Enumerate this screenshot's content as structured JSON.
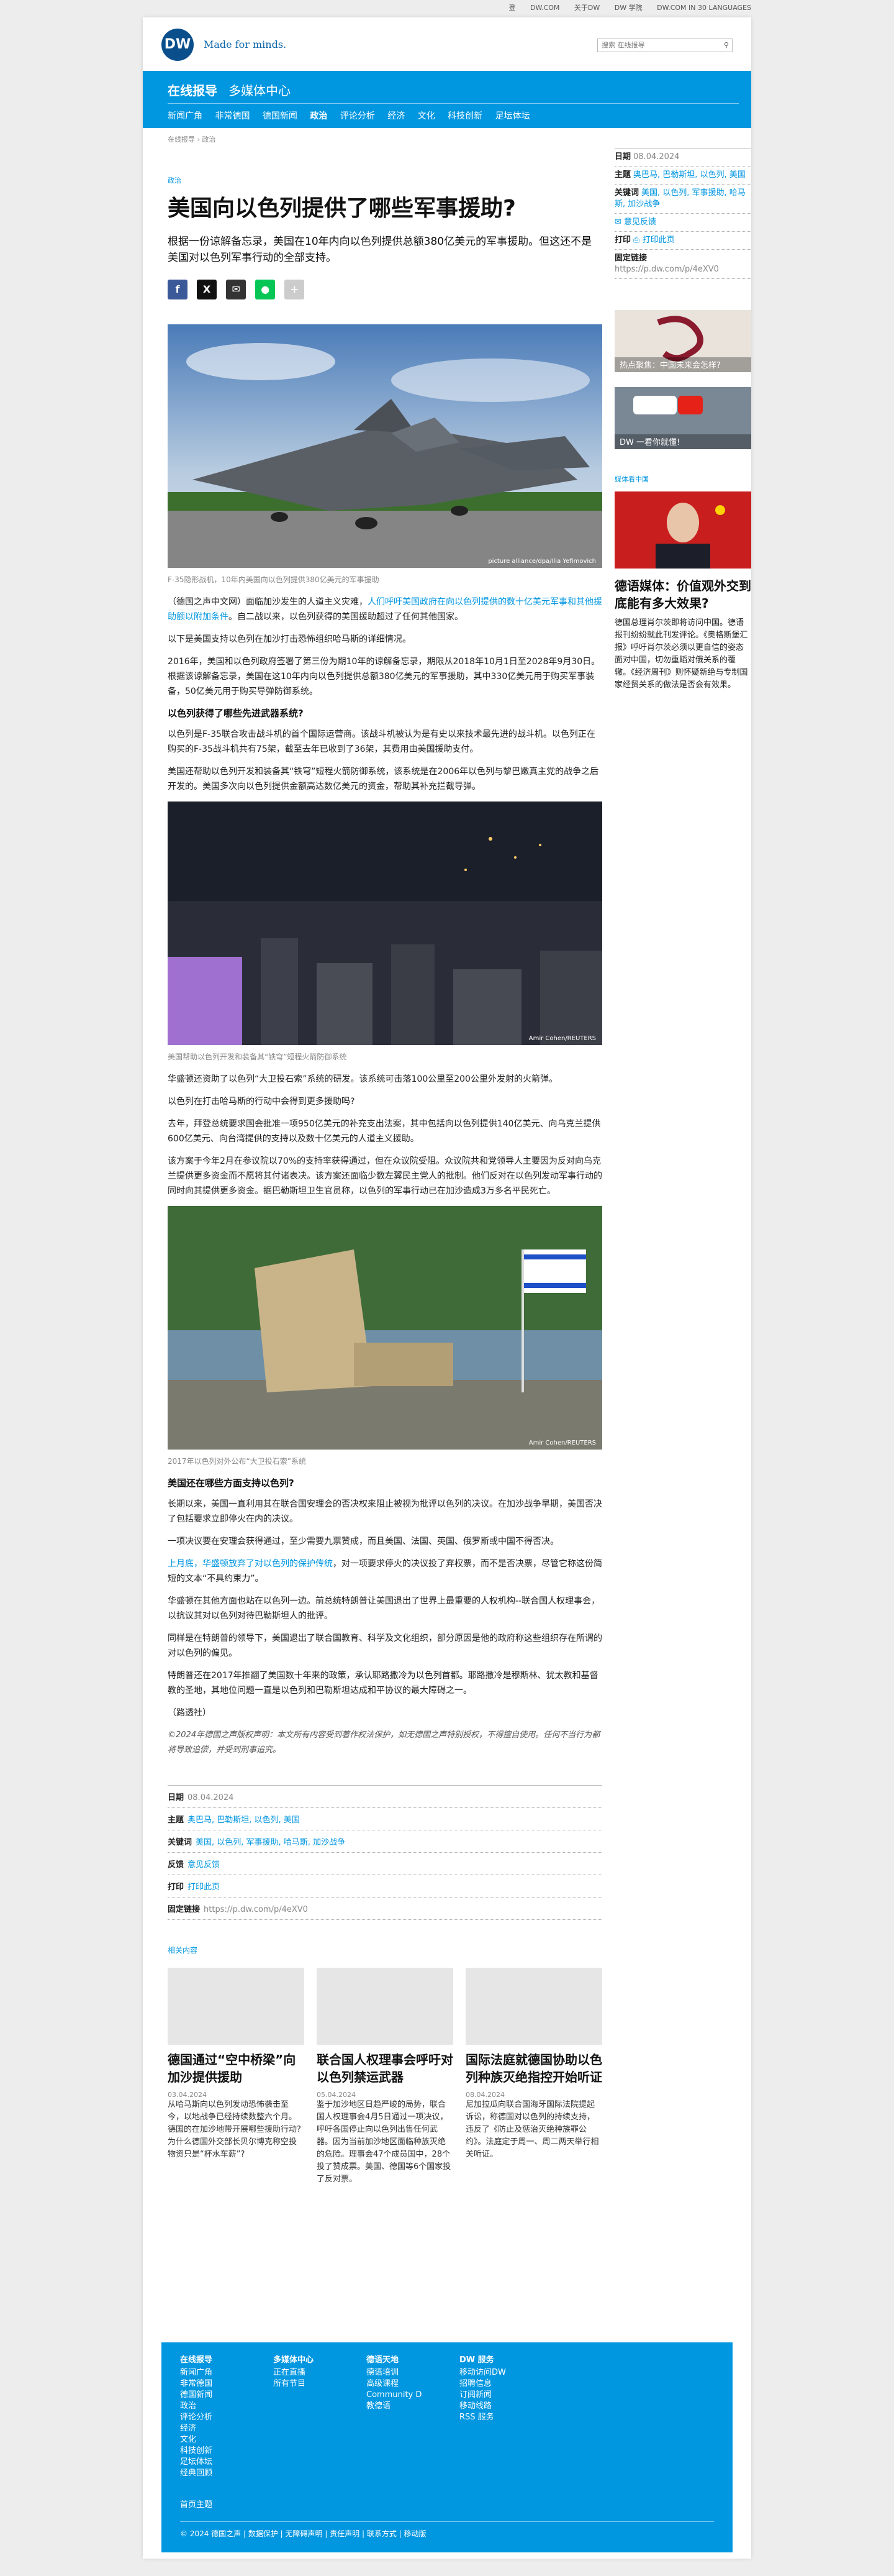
{
  "topnav": [
    "登",
    "DW.COM",
    "关于DW",
    "DW 学院",
    "DW.COM IN 30 LANGUAGES"
  ],
  "header": {
    "logo": "DW",
    "tagline": "Made for minds.",
    "search_placeholder": "搜索 在线报导"
  },
  "band": {
    "section": "在线报导",
    "media": "多媒体中心",
    "subnav": [
      "新闻广角",
      "非常德国",
      "德国新闻",
      "政治",
      "评论分析",
      "经济",
      "文化",
      "科技创新",
      "足坛体坛"
    ]
  },
  "breadcrumb": "在线报导 › 政治",
  "article": {
    "kicker": "政治",
    "title": "美国向以色列提供了哪些军事援助?",
    "lead": "根据一份谅解备忘录，美国在10年内向以色列提供总额380亿美元的军事援助。但这还不是美国对以色列军事行动的全部支持。",
    "img1_caption": "F-35隐形战机，10年内美国向以色列提供380亿美元的军事援助",
    "img1_credit": "picture alliance/dpa/Ilia Yefimovich",
    "p1a": "（德国之声中文网）面临加沙发生的人道主义灾难，",
    "p1link": "人们呼吁美国政府在向以色列提供的数十亿美元军事和其他援助额以附加条件",
    "p1b": "。自二战以来，以色列获得的美国援助超过了任何其他国家。",
    "p2": "以下是美国支持以色列在加沙打击恐怖组织哈马斯的详细情况。",
    "p3": "2016年，美国和以色列政府签署了第三份为期10年的谅解备忘录，期限从2018年10月1日至2028年9月30日。根据该谅解备忘录，美国在这10年内向以色列提供总额380亿美元的军事援助，其中330亿美元用于购买军事装备，50亿美元用于购买导弹防御系统。",
    "h1": "以色列获得了哪些先进武器系统?",
    "p4": "以色列是F-35联合攻击战斗机的首个国际运营商。该战斗机被认为是有史以来技术最先进的战斗机。以色列正在购买的F-35战斗机共有75架，截至去年已收到了36架，其费用由美国援助支付。",
    "p5": "美国还帮助以色列开发和装备其“铁穹”短程火箭防御系统，该系统是在2006年以色列与黎巴嫩真主党的战争之后开发的。美国多次向以色列提供金额高达数亿美元的资金，帮助其补充拦截导弹。",
    "img2_caption": "美国帮助以色列开发和装备其“铁穹”短程火箭防御系统",
    "img2_credit": "Amir Cohen/REUTERS",
    "p6": "华盛顿还资助了以色列“大卫投石索”系统的研发。该系统可击落100公里至200公里外发射的火箭弹。",
    "p7": "以色列在打击哈马斯的行动中会得到更多援助吗?",
    "p8": "去年，拜登总统要求国会批准一项950亿美元的补充支出法案，其中包括向以色列提供140亿美元、向乌克兰提供600亿美元、向台湾提供的支持以及数十亿美元的人道主义援助。",
    "p9": "该方案于今年2月在参议院以70%的支持率获得通过，但在众议院受阻。众议院共和党领导人主要因为反对向乌克兰提供更多资金而不愿将其付诸表决。该方案还面临少数左翼民主党人的批制。他们反对在以色列发动军事行动的同时向其提供更多资金。据巴勒斯坦卫生官员称，以色列的军事行动已在加沙造成3万多名平民死亡。",
    "img3_caption": "2017年以色列对外公布“大卫投石索”系统",
    "img3_credit": "Amir Cohen/REUTERS",
    "h2": "美国还在哪些方面支持以色列?",
    "p10": "长期以来，美国一直利用其在联合国安理会的否决权来阻止被视为批评以色列的决议。在加沙战争早期，美国否决了包括要求立即停火在内的决议。",
    "p11": "一项决议要在安理会获得通过，至少需要九票赞成，而且美国、法国、英国、俄罗斯或中国不得否决。",
    "p12link": "上月底，华盛顿放弃了对以色列的保护传统",
    "p12b": "，对一项要求停火的决议投了弃权票，而不是否决票，尽管它称这份简短的文本“不具约束力”。",
    "p13": "华盛顿在其他方面也站在以色列一边。前总统特朗普让美国退出了世界上最重要的人权机构--联合国人权理事会，以抗议其对以色列对待巴勒斯坦人的批评。",
    "p14": "同样是在特朗普的领导下，美国退出了联合国教育、科学及文化组织，部分原因是他的政府称这些组织存在所谓的对以色列的偏见。",
    "p15": "特朗普还在2017年推翻了美国数十年来的政策，承认耶路撒冷为以色列首都。耶路撒冷是穆斯林、犹太教和基督教的圣地，其地位问题一直是以色列和巴勒斯坦达成和平协议的最大障碍之一。",
    "p16": "（路透社）",
    "copyright": "©2024年德国之声版权声明：本文所有内容受到著作权法保护，如无德国之声特别授权，不得擅自使用。任何不当行为都将导致追偿，并受到刑事追究。"
  },
  "meta": {
    "date_label": "日期",
    "date": "08.04.2024",
    "topic_label": "主题",
    "topics": "奥巴马, 巴勒斯坦, 以色列, 美国",
    "keywords_label": "关键词",
    "keywords": "美国, 以色列, 军事援助, 哈马斯, 加沙战争",
    "feedback_label": "反馈",
    "feedback": "意见反馈",
    "print_label": "打印",
    "print": "打印此页",
    "link_label": "固定链接",
    "link": "https://p.dw.com/p/4eXV0"
  },
  "sidebar": {
    "feedback_link": "意见反馈",
    "print_link": "打印此页",
    "ad1": "热点聚焦：中国未来会怎样?",
    "ad2": "DW 一看你就懂!",
    "media_label": "媒体看中国",
    "story_title": "德语媒体：价值观外交到底能有多大效果?",
    "story_text": "德国总理肖尔茨即将访问中国。德语报刊纷纷就此刊发评论。《奥格斯堡汇报》呼吁肖尔茨必须以更自信的姿态面对中国，切勿重蹈对俄关系的覆辙。《经济周刊》则怀疑新绝与专制国家经贸关系的做法是否会有效果。"
  },
  "related": {
    "label": "相关内容",
    "cards": [
      {
        "title": "德国通过“空中桥梁”向加沙提供援助",
        "date": "03.04.2024",
        "text": "从哈马斯向以色列发动恐怖袭击至今，以地战争已经持续数整六个月。德国的在加沙地带开展哪些援助行动? 为什么德国外交部长贝尔博克称空投物资只是“杯水车薪”?"
      },
      {
        "title": "联合国人权理事会呼吁对以色列禁运武器",
        "date": "05.04.2024",
        "text": "鉴于加沙地区日趋严峻的局势，联合国人权理事会4月5日通过一项决议，呼吁各国停止向以色列出售任何武器。因为当前加沙地区面临种族灭绝的危险。理事会47个成员国中，28个投了赞成票。美国、德国等6个国家投了反对票。"
      },
      {
        "title": "国际法庭就德国协助以色列种族灭绝指控开始听证",
        "date": "08.04.2024",
        "text": "尼加拉瓜向联合国海牙国际法院提起诉讼，称德国对以色列的持续支持，违反了《防止及惩治灭绝种族罪公约》。法庭定于周一、周二两天举行相关听证。"
      }
    ]
  },
  "footer": {
    "cols": [
      {
        "head": "在线报导",
        "items": [
          "新闻广角",
          "非常德国",
          "德国新闻",
          "政治",
          "评论分析",
          "经济",
          "文化",
          "科技创新",
          "足坛体坛",
          "经典回顾"
        ]
      },
      {
        "head": "多媒体中心",
        "items": [
          "正在直播",
          "所有节目"
        ]
      },
      {
        "head": "德语天地",
        "items": [
          "德语培训",
          "高级课程",
          "Community D",
          "教德语"
        ]
      },
      {
        "head": "DW 服务",
        "items": [
          "移动访问DW",
          "招聘信息",
          "订阅新闻",
          "移动线路",
          "RSS 服务"
        ]
      }
    ],
    "home": "首页主题",
    "bottom": "© 2024 德国之声 | 数据保护 | 无障碍声明 | 责任声明 | 联系方式 | 移动版"
  },
  "colors": {
    "brand_blue": "#0096e0",
    "dark_blue": "#0a4f8c"
  }
}
